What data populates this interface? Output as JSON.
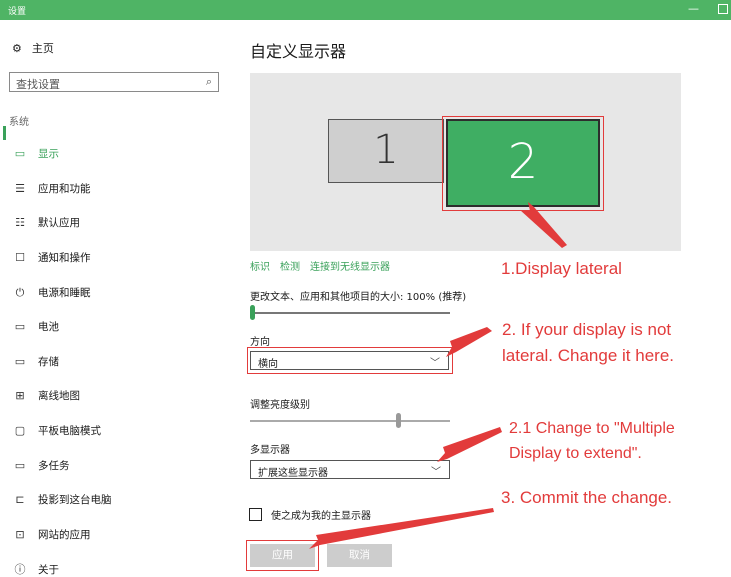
{
  "window": {
    "title": "设置",
    "min_glyph": "—"
  },
  "sidebar": {
    "home": {
      "icon": "gear-icon",
      "label": "主页"
    },
    "search": {
      "placeholder": "查找设置",
      "icon": "search-icon"
    },
    "section": "系统",
    "items": [
      {
        "icon": "monitor-icon",
        "label": "显示",
        "active": true
      },
      {
        "icon": "list-icon",
        "label": "应用和功能"
      },
      {
        "icon": "default-apps-icon",
        "label": "默认应用"
      },
      {
        "icon": "chat-icon",
        "label": "通知和操作"
      },
      {
        "icon": "power-icon",
        "label": "电源和睡眠"
      },
      {
        "icon": "battery-icon",
        "label": "电池"
      },
      {
        "icon": "storage-icon",
        "label": "存储"
      },
      {
        "icon": "map-icon",
        "label": "离线地图"
      },
      {
        "icon": "tablet-icon",
        "label": "平板电脑模式"
      },
      {
        "icon": "multitask-icon",
        "label": "多任务"
      },
      {
        "icon": "project-icon",
        "label": "投影到这台电脑"
      },
      {
        "icon": "web-app-icon",
        "label": "网站的应用"
      },
      {
        "icon": "info-icon",
        "label": "关于"
      }
    ]
  },
  "main": {
    "title": "自定义显示器",
    "monitors": [
      "1",
      "2"
    ],
    "links": [
      "标识",
      "检测",
      "连接到无线显示器"
    ],
    "scale_label": "更改文本、应用和其他项目的大小: 100% (推荐)",
    "scale_value": 0,
    "orientation_label": "方向",
    "orientation_value": "横向",
    "brightness_label": "调整亮度级别",
    "brightness_value": 0.75,
    "multi_label": "多显示器",
    "multi_value": "扩展这些显示器",
    "main_display_label": "使之成为我的主显示器",
    "apply": "应用",
    "cancel": "取消"
  },
  "annotations": {
    "a1": "1.Display lateral",
    "a2_line1": "2. If your display is not",
    "a2_line2": "lateral. Change it here.",
    "a3_line1": "2.1 Change to \"Multiple",
    "a3_line2": "Display to extend\".",
    "a4": "3. Commit the change."
  },
  "colors": {
    "accent": "#3aa15a",
    "titlebar": "#4fb465",
    "annotation": "#e23b3b"
  }
}
